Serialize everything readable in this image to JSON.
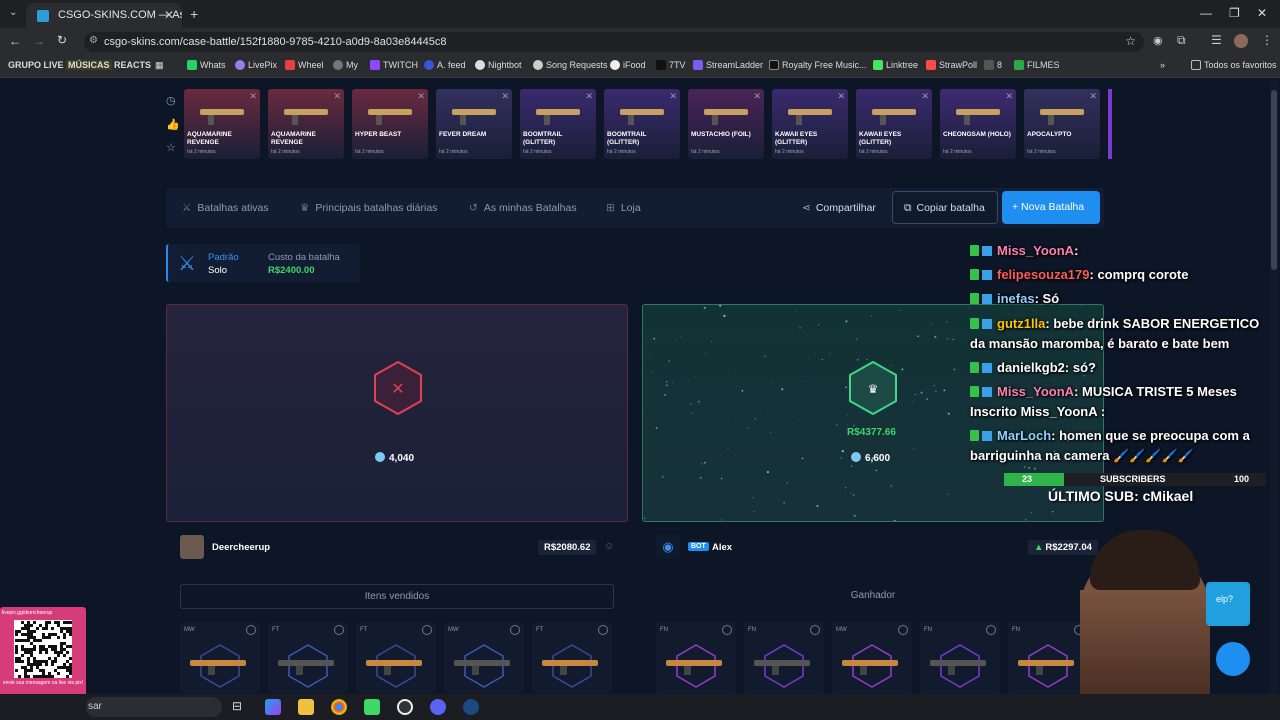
{
  "browser": {
    "tab_title": "CSGO-SKINS.COM — As melhor",
    "url": "csgo-skins.com/case-battle/152f1880-9785-4210-a0d9-8a03e84445c8",
    "bookmarks": [
      "GRUPO LIVE",
      "MÚSICAS",
      "REACTS",
      "Whats",
      "LivePix",
      "Wheel",
      "My",
      "TWITCH",
      "A. feed",
      "Nightbot",
      "Song Requests",
      "iFood",
      "7TV",
      "StreamLadder",
      "Royalty Free Music...",
      "Linktree",
      "StrawPoll",
      "8",
      "FILMES"
    ],
    "bookmarks_right": "Todos os favoritos"
  },
  "recent_drops": [
    {
      "name": "AQUAMARINE REVENGE",
      "time": "há 2 minutos",
      "color": "#6a2a3f"
    },
    {
      "name": "AQUAMARINE REVENGE",
      "time": "há 2 minutos",
      "color": "#6a2a3f"
    },
    {
      "name": "HYPER BEAST",
      "time": "há 2 minutos",
      "color": "#6a2a3f"
    },
    {
      "name": "FEVER DREAM",
      "time": "há 2 minutos",
      "color": "#33305e"
    },
    {
      "name": "BOOMTRAIL (GLITTER)",
      "time": "há 2 minutos",
      "color": "#3a2a6e"
    },
    {
      "name": "BOOMTRAIL (GLITTER)",
      "time": "há 2 minutos",
      "color": "#3a2a6e"
    },
    {
      "name": "MUSTACHIO (FOIL)",
      "time": "há 2 minutos",
      "color": "#4a2358"
    },
    {
      "name": "KAWAII EYES (GLITTER)",
      "time": "há 2 minutos",
      "color": "#3a2a6e"
    },
    {
      "name": "KAWAII EYES (GLITTER)",
      "time": "há 2 minutos",
      "color": "#3a2a6e"
    },
    {
      "name": "CHEONGSAM (HOLO)",
      "time": "há 2 minutos",
      "color": "#3e2a72"
    },
    {
      "name": "APOCALYPTO",
      "time": "há 2 minutos",
      "color": "#33305e"
    }
  ],
  "nav": {
    "active": "Batalhas ativas",
    "daily": "Principais batalhas diárias",
    "mine": "As minhas Batalhas",
    "store": "Loja",
    "share": "Compartilhar",
    "copy": "Copiar batalha",
    "new": "+ Nova Batalha"
  },
  "mode": {
    "label": "Padrão",
    "value": "Solo",
    "cost_label": "Custo da batalha",
    "cost": "R$2400.00"
  },
  "left": {
    "score": "4,040",
    "player": "Deercheerup",
    "total": "R$2080.62",
    "items_label": "Itens vendidos",
    "items": [
      {
        "q": "MW"
      },
      {
        "q": "FT"
      },
      {
        "q": "FT"
      },
      {
        "q": "MW"
      },
      {
        "q": "FT"
      }
    ]
  },
  "right": {
    "win_amount": "R$4377.66",
    "score": "6,600",
    "badge": "BOT",
    "player": "Alex",
    "total": "R$2297.04",
    "winner_label": "Ganhador",
    "items": [
      {
        "q": "FN"
      },
      {
        "q": "FN"
      },
      {
        "q": "MW"
      },
      {
        "q": "FN"
      },
      {
        "q": "FN"
      }
    ]
  },
  "chat": [
    {
      "user": "Miss_YoonA",
      "text": ":",
      "color": "#ff7fb0"
    },
    {
      "user": "felipesouza179",
      "text": ": comprq corote",
      "color": "#ff5a5a"
    },
    {
      "user": "inefas",
      "text": ": Só",
      "color": "#8fd0ff"
    },
    {
      "user": "gutz1lla",
      "text": ": bebe drink SABOR ENERGETICO",
      "text2": "da mansão maromba, é barato e bate bem",
      "color": "#ffc400"
    },
    {
      "user": "danielkgb2",
      "text": ": só?",
      "color": "#ffffff"
    },
    {
      "user": "Miss_YoonA",
      "text": ": MUSICA TRISTE 5 Meses",
      "text2": "Inscrito Miss_YoonA :",
      "color": "#ff7fb0"
    },
    {
      "user": "MarLoch",
      "text": ": homen que se preocupa com a",
      "text2": "barriguinha na camera 🖌️🖌️🖌️🖌️🖌️",
      "color": "#8fd0ff"
    }
  ],
  "subs": {
    "current": "23",
    "label": "SUBSCRIBERS",
    "goal": "100",
    "last_sub": "ÚLTIMO SUB: cMikael"
  },
  "overlay": {
    "qr_top": "livepix.gg/deercheerup",
    "qr_bottom": "envie sua mensagem na live via pix!",
    "help": "elp?"
  },
  "taskbar": {
    "search": "sar"
  }
}
